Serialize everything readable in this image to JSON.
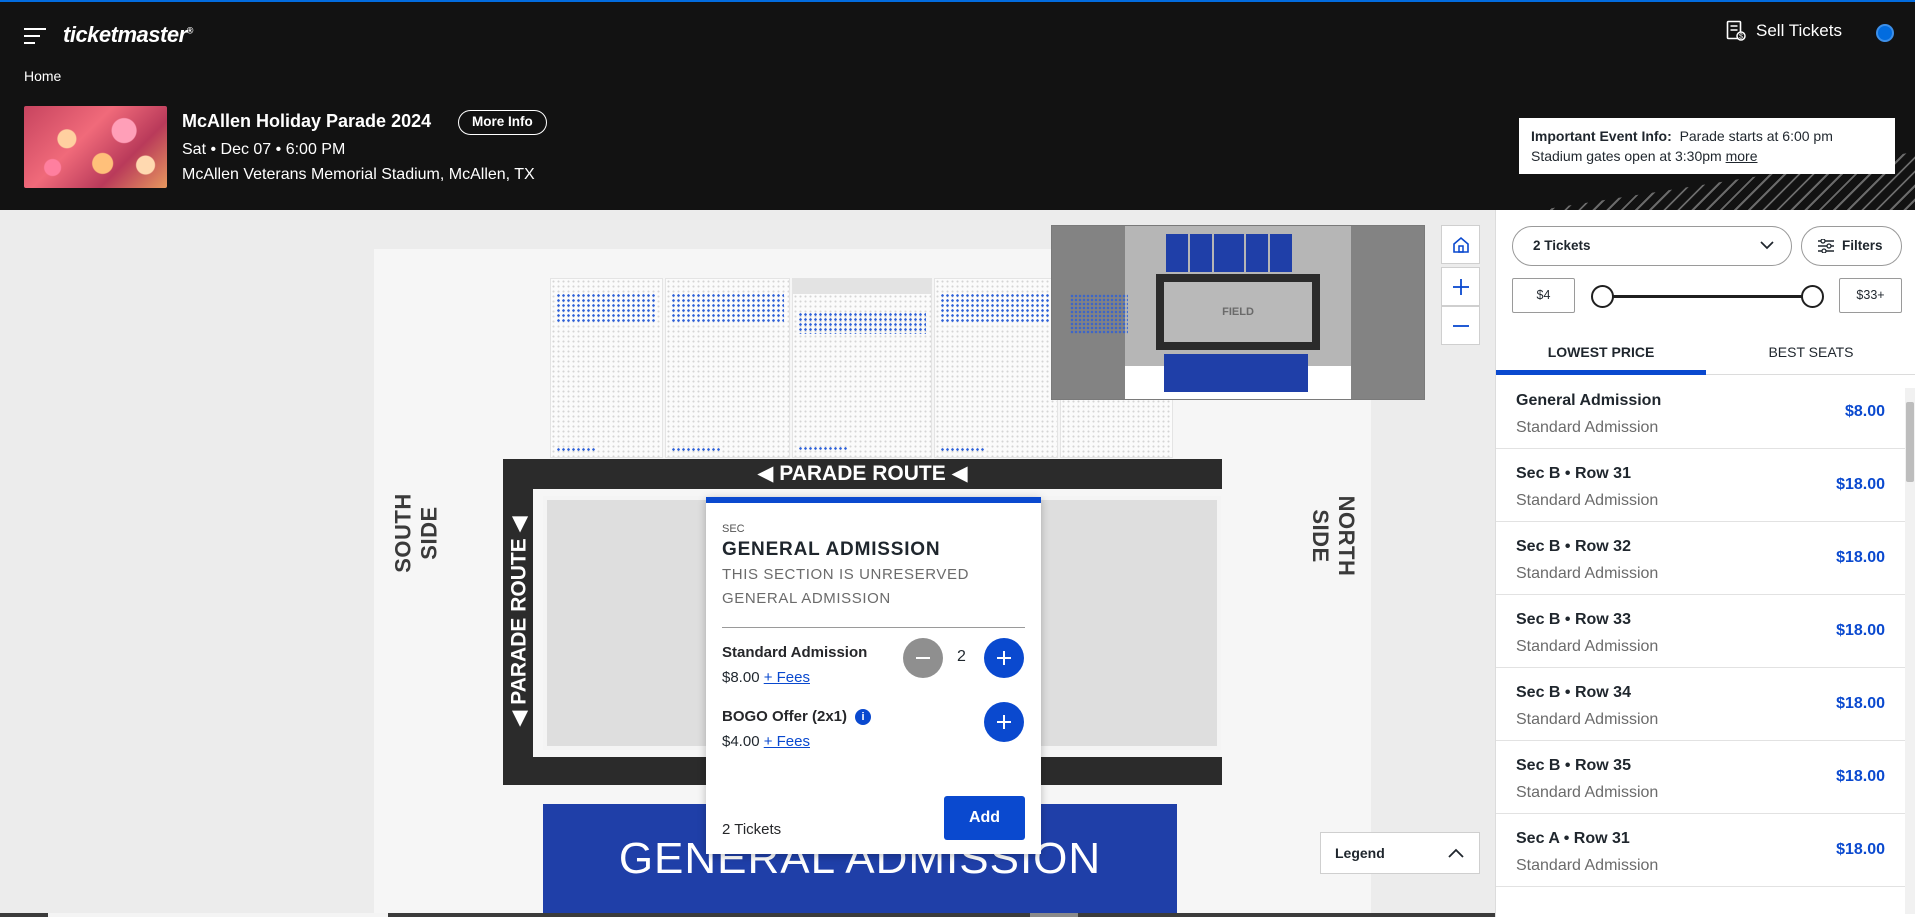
{
  "header": {
    "logo": "ticketmaster",
    "logo_mark": "®",
    "sell_label": "Sell Tickets",
    "breadcrumb": "Home"
  },
  "event": {
    "title": "McAllen Holiday Parade 2024",
    "more_info": "More Info",
    "date": "Sat • Dec 07 • 6:00 PM",
    "venue": "McAllen Veterans Memorial Stadium, McAllen, TX"
  },
  "important_info": {
    "label": "Important Event Info:",
    "line1": "Parade starts at 6:00 pm",
    "line2": "Stadium gates open at 3:30pm",
    "more": "more"
  },
  "map": {
    "parade_route": "◀ PARADE ROUTE ◀",
    "parade_route_side": "◀ PARADE ROUTE ◀",
    "south_side": "SOUTH SIDE",
    "north_side": "NORTH SIDE",
    "general_admission": "GENERAL ADMISSION",
    "minimap_field": "FIELD",
    "legend": "Legend"
  },
  "popup": {
    "sec_label": "SEC",
    "title": "GENERAL ADMISSION",
    "subtitle": "THIS SECTION IS UNRESERVED GENERAL ADMISSION",
    "offers": [
      {
        "name": "Standard Admission",
        "price": "$8.00",
        "fees": "+ Fees",
        "qty": "2"
      },
      {
        "name": "BOGO Offer (2x1)",
        "price": "$4.00",
        "fees": "+ Fees"
      }
    ],
    "footer": "2 Tickets",
    "add": "Add"
  },
  "panel": {
    "tickets": "2 Tickets",
    "filters": "Filters",
    "min_price": "$4",
    "max_price": "$33+",
    "tabs": [
      "LOWEST PRICE",
      "BEST SEATS"
    ],
    "listings": [
      {
        "title": "General Admission",
        "type": "Standard Admission",
        "price": "$8.00"
      },
      {
        "title": "Sec B • Row 31",
        "type": "Standard Admission",
        "price": "$18.00"
      },
      {
        "title": "Sec B • Row 32",
        "type": "Standard Admission",
        "price": "$18.00"
      },
      {
        "title": "Sec B • Row 33",
        "type": "Standard Admission",
        "price": "$18.00"
      },
      {
        "title": "Sec B • Row 34",
        "type": "Standard Admission",
        "price": "$18.00"
      },
      {
        "title": "Sec B • Row 35",
        "type": "Standard Admission",
        "price": "$18.00"
      },
      {
        "title": "Sec A • Row 31",
        "type": "Standard Admission",
        "price": "$18.00"
      }
    ]
  },
  "colors": {
    "accent": "#026cdf",
    "primary_button": "#0a49cf",
    "header_bg": "#121212",
    "ga_block": "#1f3fa8"
  }
}
